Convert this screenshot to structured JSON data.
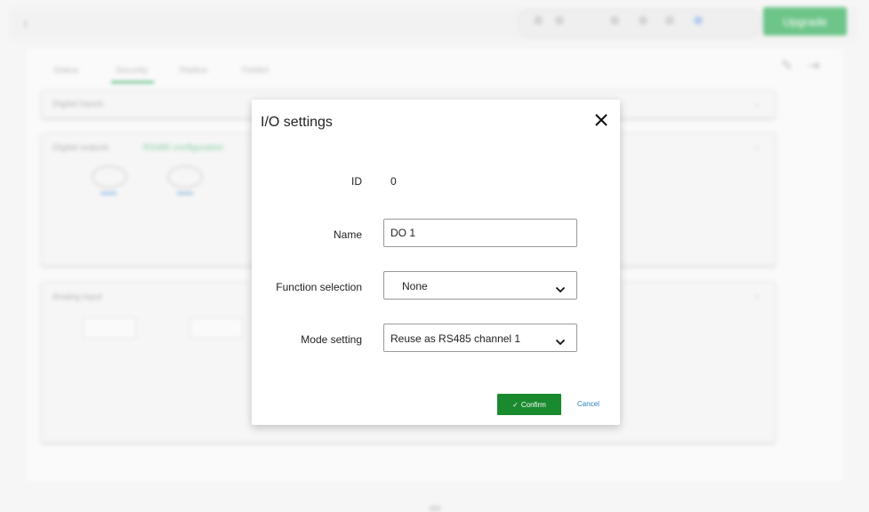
{
  "background": {
    "toolbar_button": "Upgrade",
    "tabs": [
      "Status",
      "Security",
      "Radios",
      "Fieldnt"
    ],
    "panels": [
      {
        "title": "Digital inputs"
      },
      {
        "title": "Digital outputs",
        "note": "RS485 configuration"
      },
      {
        "title": "Analog input"
      }
    ]
  },
  "dialog": {
    "title": "I/O settings",
    "rows": {
      "id": {
        "label": "ID",
        "value": "0"
      },
      "name": {
        "label": "Name",
        "value": "DO 1"
      },
      "function": {
        "label": "Function selection",
        "value": "None"
      },
      "mode": {
        "label": "Mode setting",
        "value": "Reuse as RS485 channel 1"
      }
    },
    "confirm_label": "Confirm",
    "cancel_label": "Cancel"
  },
  "colors": {
    "confirm": "#1a8a2e",
    "cancel_link": "#2a7fb8",
    "upgrade": "#1fa64a"
  },
  "icons": {
    "close": "close-icon",
    "chevron": "chevron-down-icon",
    "check": "check-icon"
  }
}
